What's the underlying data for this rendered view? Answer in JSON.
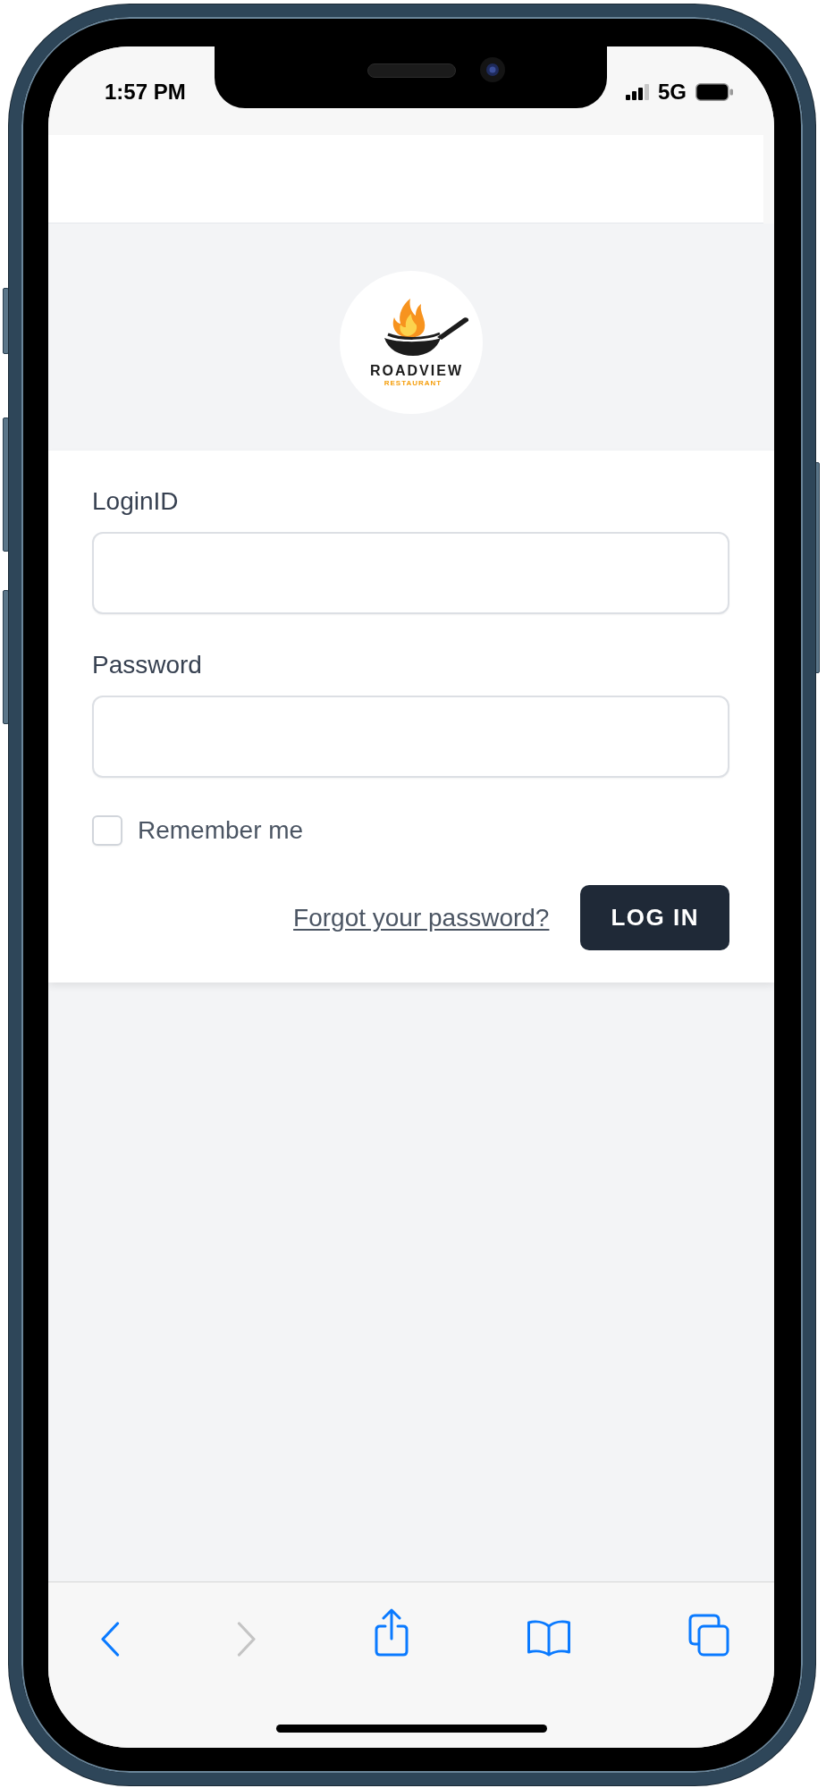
{
  "status_bar": {
    "time": "1:57 PM",
    "network": "5G"
  },
  "logo": {
    "name": "ROADVIEW",
    "tagline": "RESTAURANT"
  },
  "login_form": {
    "fields": [
      {
        "label": "LoginID"
      },
      {
        "label": "Password"
      }
    ],
    "remember_me": {
      "label": "Remember me",
      "checked": false
    },
    "forgot_password_link": "Forgot your password?",
    "submit_button": "LOG IN"
  },
  "browser_toolbar": [
    {
      "kind": "back",
      "disabled": false
    },
    {
      "kind": "forward",
      "disabled": true
    },
    {
      "kind": "share",
      "disabled": false
    },
    {
      "kind": "bookmarks",
      "disabled": false
    },
    {
      "kind": "tabs",
      "disabled": false
    }
  ]
}
